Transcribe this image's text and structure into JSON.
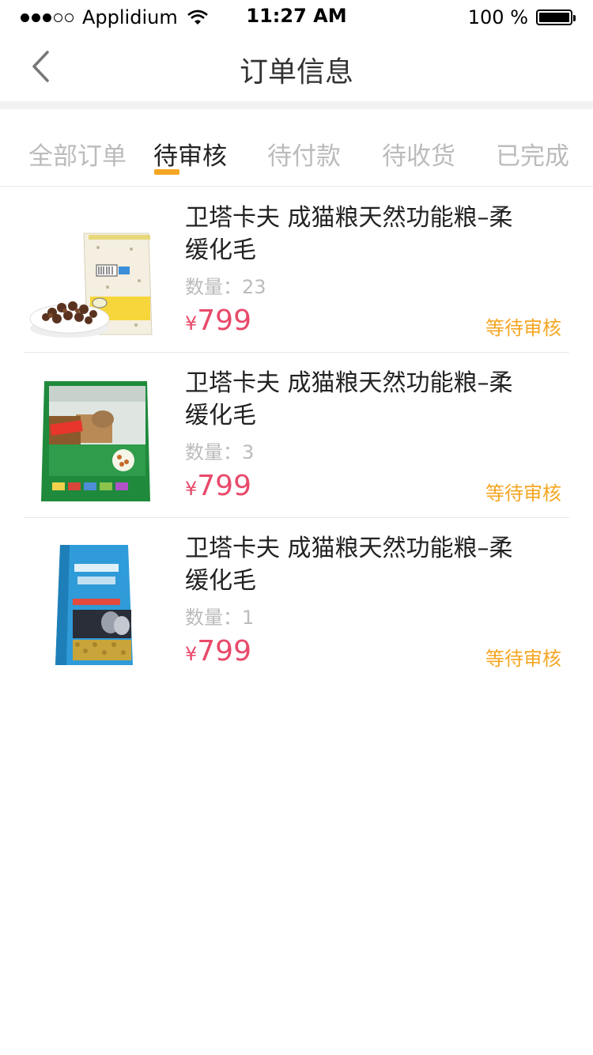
{
  "status_bar": {
    "carrier": "Applidium",
    "time": "11:27 AM",
    "battery": "100 %"
  },
  "nav": {
    "title": "订单信息",
    "back_icon": "chevron-left-icon"
  },
  "tabs": [
    {
      "label": "全部订单",
      "active": false
    },
    {
      "label": "待审核",
      "active": true
    },
    {
      "label": "待付款",
      "active": false
    },
    {
      "label": "待收货",
      "active": false
    },
    {
      "label": "已完成",
      "active": false
    }
  ],
  "orders": [
    {
      "name": "卫塔卡夫 成猫粮天然功能粮–柔缓化毛",
      "qty": "数量：23",
      "currency": "¥",
      "price": "799",
      "status": "等待审核"
    },
    {
      "name": "卫塔卡夫 成猫粮天然功能粮–柔缓化毛",
      "qty": "数量：3",
      "currency": "¥",
      "price": "799",
      "status": "等待审核"
    },
    {
      "name": "卫塔卡夫 成猫粮天然功能粮–柔缓化毛",
      "qty": "数量：1",
      "currency": "¥",
      "price": "799",
      "status": "等待审核"
    }
  ],
  "colors": {
    "accent": "#f5a623",
    "price": "#e84a6a",
    "muted": "#bbbbbb"
  }
}
